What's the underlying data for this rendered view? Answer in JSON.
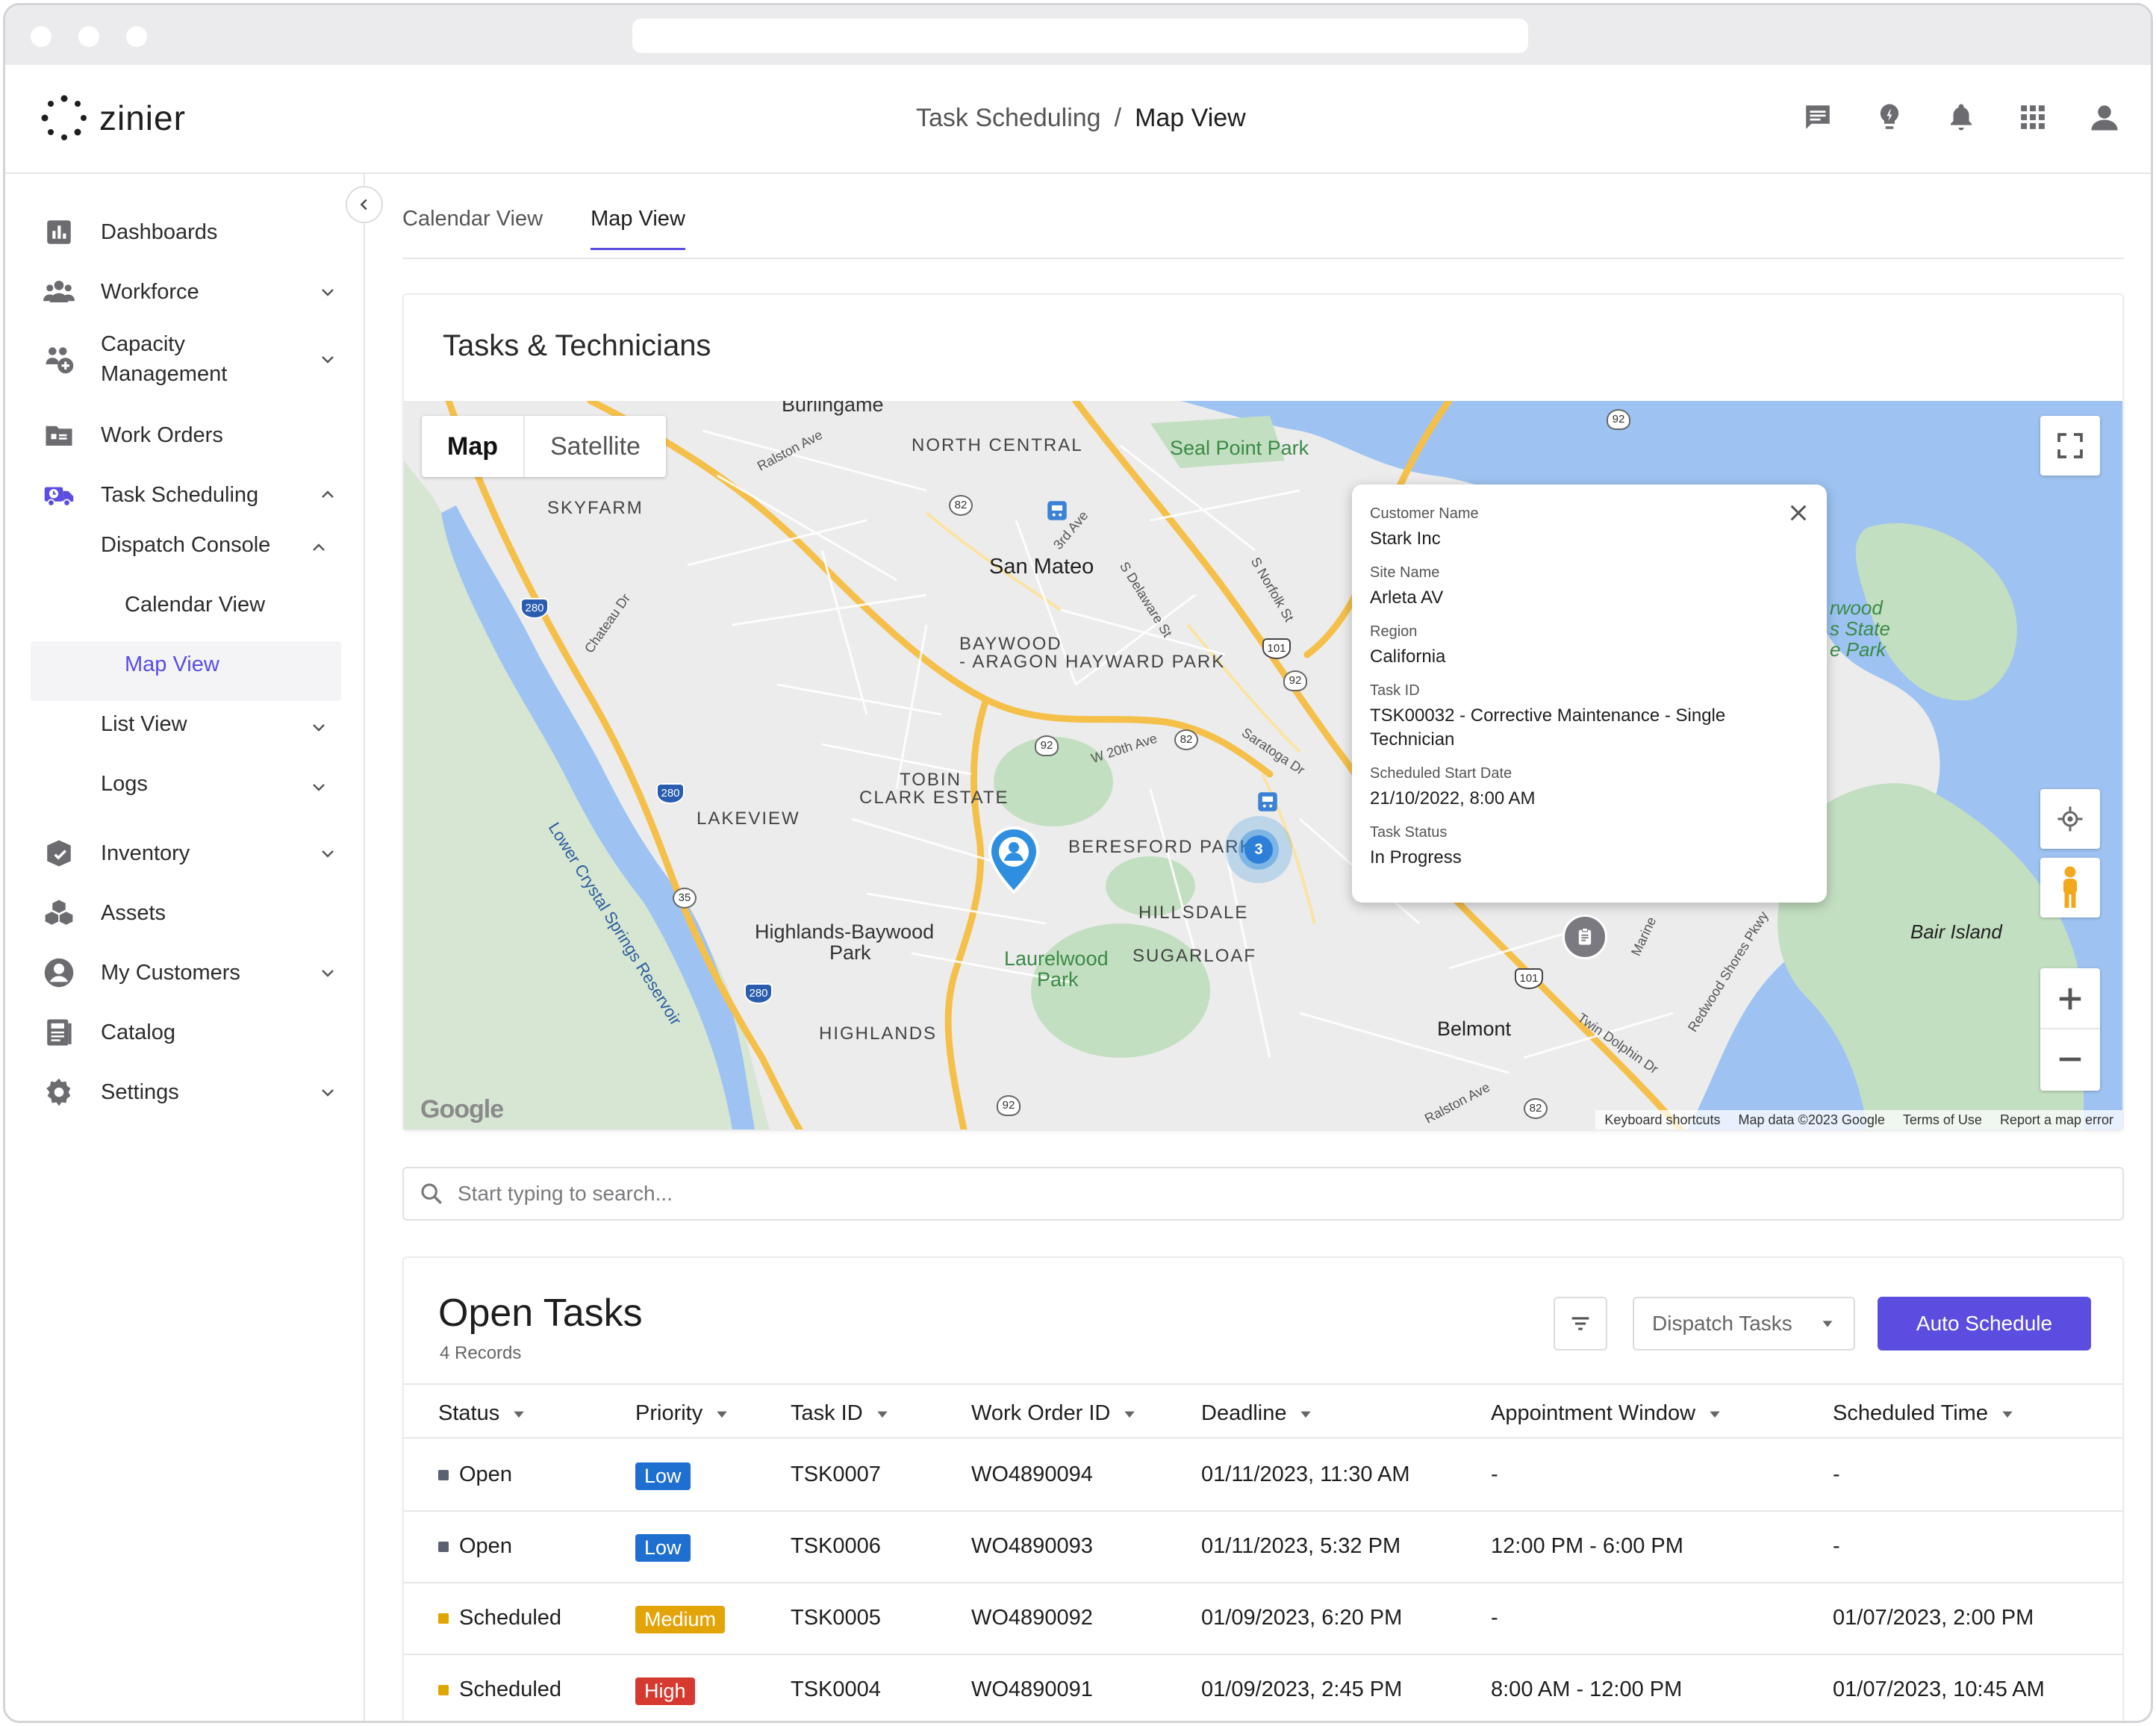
{
  "app": {
    "logo_text": "zinier"
  },
  "breadcrumb": {
    "parent": "Task Scheduling",
    "separator": "/",
    "current": "Map View"
  },
  "header_icons": [
    "chat-icon",
    "lightbulb-icon",
    "bell-icon",
    "apps-grid-icon",
    "user-icon"
  ],
  "sidebar": {
    "items": [
      {
        "label": "Dashboards",
        "icon": "bar-chart-icon",
        "chevron": false
      },
      {
        "label": "Workforce",
        "icon": "people-icon",
        "chevron": "down"
      },
      {
        "label": "Capacity\nManagement",
        "icon": "capacity-icon",
        "chevron": "down"
      },
      {
        "label": "Work Orders",
        "icon": "folder-icon",
        "chevron": false
      },
      {
        "label": "Task Scheduling",
        "icon": "truck-clock-icon",
        "chevron": "up"
      },
      {
        "label": "Inventory",
        "icon": "inventory-icon",
        "chevron": "down"
      },
      {
        "label": "Assets",
        "icon": "cubes-icon",
        "chevron": false
      },
      {
        "label": "My Customers",
        "icon": "customer-icon",
        "chevron": "down"
      },
      {
        "label": "Catalog",
        "icon": "catalog-icon",
        "chevron": false
      },
      {
        "label": "Settings",
        "icon": "gear-icon",
        "chevron": "down"
      }
    ],
    "dispatch_console": "Dispatch Console",
    "calendar_view": "Calendar View",
    "map_view": "Map View",
    "list_view": "List View",
    "logs": "Logs"
  },
  "tabs": [
    {
      "label": "Calendar View",
      "active": false
    },
    {
      "label": "Map View",
      "active": true
    }
  ],
  "map_card": {
    "title": "Tasks & Technicians",
    "map_type": {
      "map": "Map",
      "satellite": "Satellite"
    },
    "labels": {
      "burlingame": "Burlingame",
      "north_central": "NORTH CENTRAL",
      "seal_point_park": "Seal Point Park",
      "skyfarm": "SKYFARM",
      "san_mateo": "San Mateo",
      "baywood": "BAYWOOD",
      "aragon": "- ARAGON",
      "hayward_park": "HAYWARD PARK",
      "tobin": "TOBIN",
      "clark_estate": "CLARK ESTATE",
      "lakeview": "LAKEVIEW",
      "beresford_park": "BERESFORD PARK",
      "highlands_baywood": "Highlands-Baywood",
      "park": "Park",
      "hillsdale": "HILLSDALE",
      "laurelwood": "Laurelwood",
      "laurelwood_park": "Park",
      "sugarloaf": "SUGARLOAF",
      "highlands": "HIGHLANDS",
      "belmont": "Belmont",
      "bair_island": "Bair Island",
      "redwood1": "rwood",
      "redwood2": "s State",
      "redwood3": "e Park",
      "crystal_springs": "Lower Crystal Springs Reservoir",
      "ralston_ave": "Ralston Ave",
      "chateau_dr": "Chateau Dr",
      "third_ave": "3rd Ave",
      "s_delaware": "S Delaware St",
      "s_norfolk": "S Norfolk St",
      "w20th": "W 20th Ave",
      "saratoga": "Saratoga Dr",
      "twin_dolphin": "Twin Dolphin Dr",
      "redwood_shores": "Redwood Shores Pkwy",
      "marine": "Marine",
      "ralston_ave2": "Ralston Ave",
      "r92a": "92",
      "r92b": "92",
      "r92c": "92",
      "r92d": "92",
      "r82a": "82",
      "r82b": "82",
      "r82c": "82",
      "r280a": "280",
      "r280b": "280",
      "r280c": "280",
      "r101a": "101",
      "r101b": "101",
      "r35": "35"
    },
    "cluster_count": "3",
    "popup": {
      "fields": [
        {
          "label": "Customer Name",
          "value": "Stark Inc"
        },
        {
          "label": "Site Name",
          "value": "Arleta AV"
        },
        {
          "label": "Region",
          "value": "California"
        },
        {
          "label": "Task ID",
          "value": "TSK00032 - Corrective Maintenance - Single Technician"
        },
        {
          "label": "Scheduled Start Date",
          "value": "21/10/2022, 8:00 AM"
        },
        {
          "label": "Task Status",
          "value": "In Progress"
        }
      ]
    },
    "google_logo": "Google",
    "footer": [
      "Keyboard shortcuts",
      "Map data ©2023 Google",
      "Terms of Use",
      "Report a map error"
    ]
  },
  "search": {
    "placeholder": "Start typing to search..."
  },
  "tasks": {
    "title": "Open Tasks",
    "count": "4 Records",
    "dispatch_select": "Dispatch Tasks",
    "auto_schedule": "Auto Schedule",
    "columns": [
      "Status",
      "Priority",
      "Task ID",
      "Work Order ID",
      "Deadline",
      "Appointment Window",
      "Scheduled Time"
    ],
    "rows": [
      {
        "status": "Open",
        "priority": "Low",
        "task_id": "TSK0007",
        "work_order_id": "WO4890094",
        "deadline": "01/11/2023, 11:30 AM",
        "window": "-",
        "scheduled": "-"
      },
      {
        "status": "Open",
        "priority": "Low",
        "task_id": "TSK0006",
        "work_order_id": "WO4890093",
        "deadline": "01/11/2023, 5:32 PM",
        "window": "12:00 PM - 6:00 PM",
        "scheduled": "-"
      },
      {
        "status": "Scheduled",
        "priority": "Medium",
        "task_id": "TSK0005",
        "work_order_id": "WO4890092",
        "deadline": "01/09/2023, 6:20 PM",
        "window": "-",
        "scheduled": "01/07/2023, 2:00 PM"
      },
      {
        "status": "Scheduled",
        "priority": "High",
        "task_id": "TSK0004",
        "work_order_id": "WO4890091",
        "deadline": "01/09/2023, 2:45 PM",
        "window": "8:00 AM - 12:00 PM",
        "scheduled": "01/07/2023, 10:45 AM"
      }
    ]
  },
  "colors": {
    "accent": "#5b4de0",
    "status_open": "#5b6170",
    "status_scheduled": "#e0a600",
    "priority_low": "#1f6fd1",
    "priority_medium": "#e3a40a",
    "priority_high": "#d6392f",
    "map_water": "#9ec3f2",
    "map_park": "#c6e3c3",
    "map_road": "#f7c04a"
  }
}
